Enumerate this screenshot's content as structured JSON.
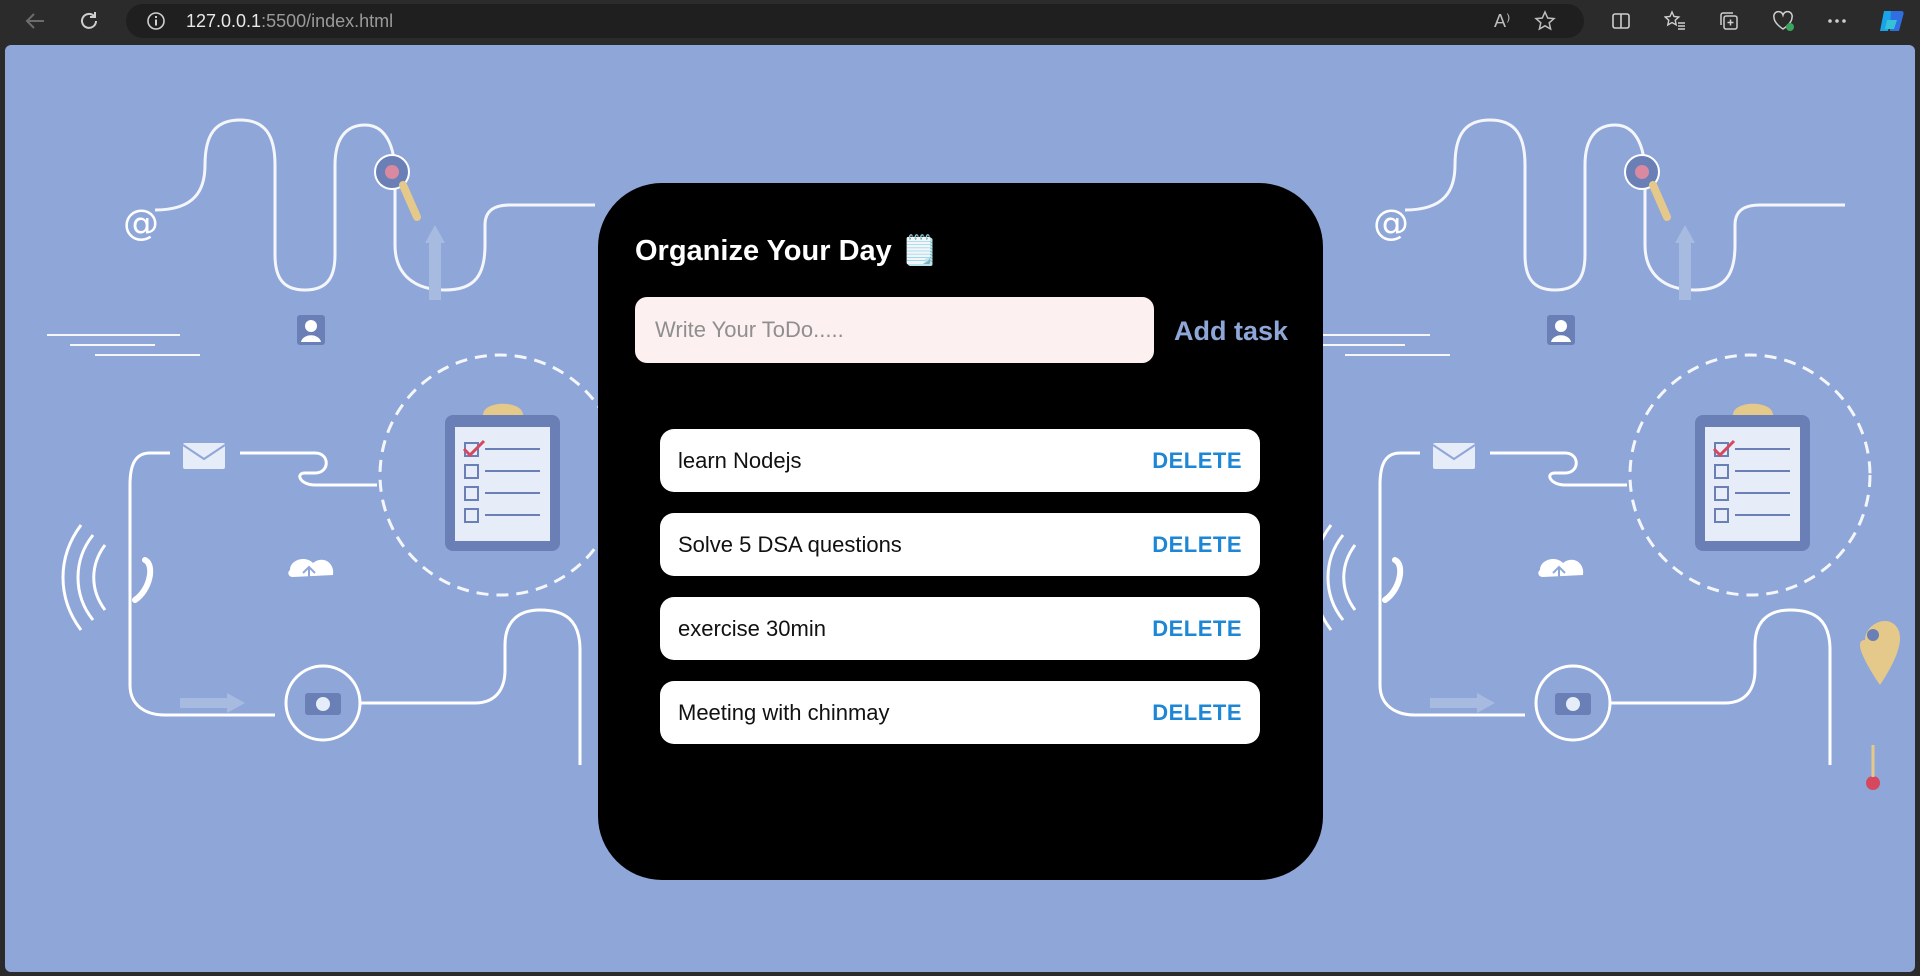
{
  "browser": {
    "url_host": "127.0.0.1",
    "url_rest": ":5500/index.html",
    "read_aloud_label": "A⁾"
  },
  "app": {
    "title": "Organize Your Day",
    "title_emoji": "🗒️",
    "input": {
      "placeholder": "Write Your ToDo.....",
      "value": ""
    },
    "add_label": "Add task",
    "delete_label": "DELETE",
    "tasks": [
      {
        "text": "learn Nodejs"
      },
      {
        "text": "Solve 5 DSA questions"
      },
      {
        "text": "exercise 30min"
      },
      {
        "text": "Meeting with chinmay"
      }
    ]
  },
  "colors": {
    "page_background": "#8fa6d8",
    "card": "#000000",
    "input_bg": "#fcf0f0",
    "add_task": "#8fa6d8",
    "delete": "#1d87d6"
  }
}
